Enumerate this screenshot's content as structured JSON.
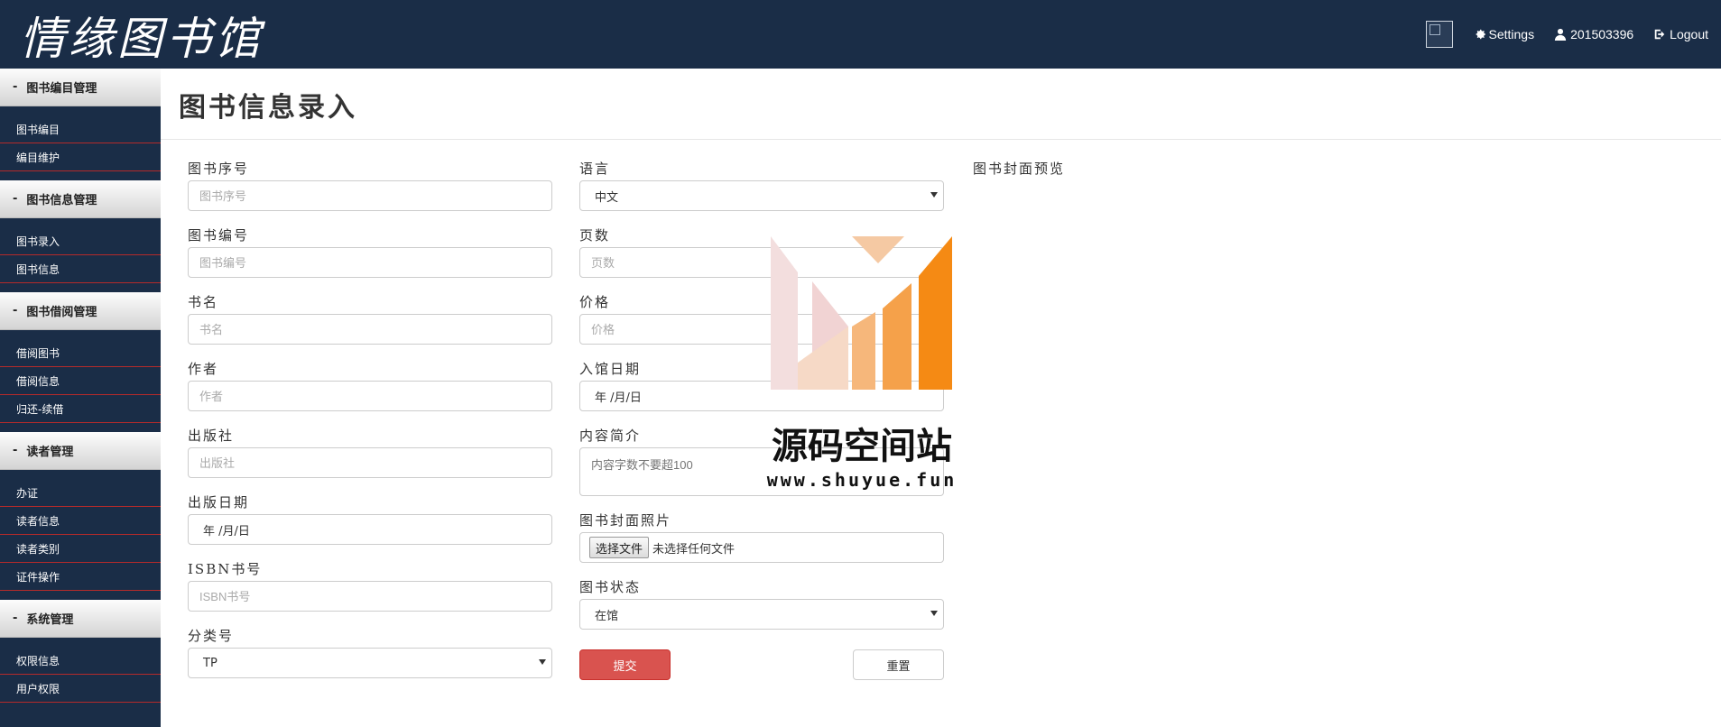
{
  "header": {
    "logo_text": "情缘图书馆",
    "settings_label": "Settings",
    "user_label": "201503396",
    "logout_label": "Logout"
  },
  "sidebar": {
    "groups": [
      {
        "title": "图书编目管理",
        "items": [
          "图书编目",
          "编目维护"
        ]
      },
      {
        "title": "图书信息管理",
        "items": [
          "图书录入",
          "图书信息"
        ]
      },
      {
        "title": "图书借阅管理",
        "items": [
          "借阅图书",
          "借阅信息",
          "归还-续借"
        ]
      },
      {
        "title": "读者管理",
        "items": [
          "办证",
          "读者信息",
          "读者类别",
          "证件操作"
        ]
      },
      {
        "title": "系统管理",
        "items": [
          "权限信息",
          "用户权限"
        ]
      }
    ]
  },
  "main": {
    "title": "图书信息录入",
    "form": {
      "book_seq": {
        "label": "图书序号",
        "placeholder": "图书序号"
      },
      "book_code": {
        "label": "图书编号",
        "placeholder": "图书编号"
      },
      "book_name": {
        "label": "书名",
        "placeholder": "书名"
      },
      "author": {
        "label": "作者",
        "placeholder": "作者"
      },
      "publisher": {
        "label": "出版社",
        "placeholder": "出版社"
      },
      "pub_date": {
        "label": "出版日期",
        "value": "年 /月/日"
      },
      "isbn": {
        "label": "ISBN书号",
        "placeholder": "ISBN书号"
      },
      "category": {
        "label": "分类号",
        "value": "TP"
      },
      "language": {
        "label": "语言",
        "value": "中文"
      },
      "pages": {
        "label": "页数",
        "placeholder": "页数"
      },
      "price": {
        "label": "价格",
        "placeholder": "价格"
      },
      "entry_date": {
        "label": "入馆日期",
        "value": "年 /月/日"
      },
      "summary": {
        "label": "内容简介",
        "placeholder": "内容字数不要超100"
      },
      "cover": {
        "label": "图书封面照片",
        "button": "选择文件",
        "status": "未选择任何文件"
      },
      "status": {
        "label": "图书状态",
        "value": "在馆"
      },
      "submit_label": "提交",
      "reset_label": "重置"
    },
    "preview_label": "图书封面预览"
  },
  "watermark": {
    "name": "源码空间站",
    "url": "www.shuyue.fun"
  },
  "colors": {
    "navbar": "#1a2d47",
    "submit": "#d9534f",
    "sidebar_divider": "#b52a2a"
  }
}
